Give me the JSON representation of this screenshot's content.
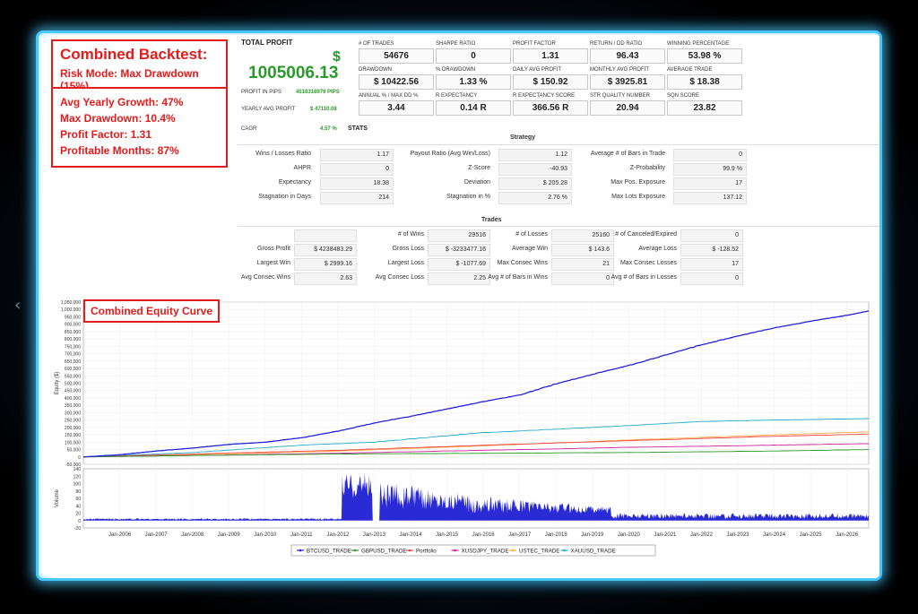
{
  "summary_box": {
    "title": "Combined Backtest:",
    "risk_mode": "Risk Mode: Max Drawdown (15%)",
    "avg_growth": "Avg Yearly Growth: 47%",
    "max_drawdown": "Max Drawdown: 10.4%",
    "profit_factor": "Profit Factor: 1.31",
    "profitable_months": "Profitable Months: 87%"
  },
  "total_profit": {
    "label": "TOTAL PROFIT",
    "currency": "$",
    "value": "1005006.13",
    "pips_label": "PROFIT IN PIPS",
    "pips_value": "4518318979 PIPS",
    "yearly_avg_label": "YEARLY AVG PROFIT",
    "yearly_avg_value": "$ 47110.08",
    "cagr_label": "CAGR",
    "cagr_value": "4.57 %",
    "stats_label": "STATS"
  },
  "stat_grid": [
    {
      "label": "# OF TRADES",
      "value": "54676"
    },
    {
      "label": "SHARPE RATIO",
      "value": "0"
    },
    {
      "label": "PROFIT FACTOR",
      "value": "1.31"
    },
    {
      "label": "RETURN / DD RATIO",
      "value": "96.43"
    },
    {
      "label": "WINNING PERCENTAGE",
      "value": "53.98 %"
    },
    {
      "label": "DRAWDOWN",
      "value": "$ 10422.56"
    },
    {
      "label": "% DRAWDOWN",
      "value": "1.33 %"
    },
    {
      "label": "DAILY AVG PROFIT",
      "value": "$ 150.92"
    },
    {
      "label": "MONTHLY AVG PROFIT",
      "value": "$ 3925.81"
    },
    {
      "label": "AVERAGE TRADE",
      "value": "$ 18.38"
    },
    {
      "label": "ANNUAL % / MAX DD %",
      "value": "3.44"
    },
    {
      "label": "R EXPECTANCY",
      "value": "0.14 R"
    },
    {
      "label": "R EXPECTANCY SCORE",
      "value": "366.56 R"
    },
    {
      "label": "STR QUALITY NUMBER",
      "value": "20.94"
    },
    {
      "label": "SQN SCORE",
      "value": "23.82"
    }
  ],
  "strategy": {
    "title": "Strategy",
    "rows": [
      [
        {
          "label": "Wins / Losses Ratio",
          "value": "1.17"
        },
        {
          "label": "Payout Ratio (Avg Win/Loss)",
          "value": "1.12"
        },
        {
          "label": "Average # of Bars in Trade",
          "value": "0"
        }
      ],
      [
        {
          "label": "AHPR",
          "value": "0"
        },
        {
          "label": "Z-Score",
          "value": "-40.93"
        },
        {
          "label": "Z-Probability",
          "value": "99.9 %"
        }
      ],
      [
        {
          "label": "Expectancy",
          "value": "18.38"
        },
        {
          "label": "Deviation",
          "value": "$ 205.28"
        },
        {
          "label": "Max Pos. Exposure",
          "value": "17"
        }
      ],
      [
        {
          "label": "Stagnation in Days",
          "value": "214"
        },
        {
          "label": "Stagnation in %",
          "value": "2.76 %"
        },
        {
          "label": "Max Lots Exposure",
          "value": "137.12"
        }
      ]
    ]
  },
  "trades": {
    "title": "Trades",
    "rows": [
      [
        {
          "label": "",
          "value": ""
        },
        {
          "label": "# of Wins",
          "value": "29516"
        },
        {
          "label": "# of Losses",
          "value": "25160"
        },
        {
          "label": "# of Canceled/Expired",
          "value": "0"
        }
      ],
      [
        {
          "label": "Gross Profit",
          "value": "$ 4238483.29"
        },
        {
          "label": "Gross Loss",
          "value": "$ -3233477.16"
        },
        {
          "label": "Average Win",
          "value": "$ 143.6"
        },
        {
          "label": "Average Loss",
          "value": "$ -128.52"
        }
      ],
      [
        {
          "label": "Largest Win",
          "value": "$ 2999.16"
        },
        {
          "label": "Largest Loss",
          "value": "$ -1077.69"
        },
        {
          "label": "Max Consec Wins",
          "value": "21"
        },
        {
          "label": "Max Consec Losses",
          "value": "17"
        }
      ],
      [
        {
          "label": "Avg Consec Wins",
          "value": "2.63"
        },
        {
          "label": "Avg Consec Loss",
          "value": "2.25"
        },
        {
          "label": "Avg # of Bars in Wins",
          "value": "0"
        },
        {
          "label": "Avg # of Bars in Losses",
          "value": "0"
        }
      ]
    ]
  },
  "equity_label": "Combined Equity Curve",
  "chart_data": {
    "type": "line",
    "ylabel": "Equity ($)",
    "ylim": [
      -50000,
      1050000
    ],
    "y_ticks": [
      "1,050,000",
      "1,000,000",
      "950,000",
      "900,000",
      "850,000",
      "800,000",
      "750,000",
      "700,000",
      "650,000",
      "600,000",
      "550,000",
      "500,000",
      "450,000",
      "400,000",
      "350,000",
      "300,000",
      "250,000",
      "200,000",
      "150,000",
      "100,000",
      "50,000",
      "0",
      "-50,000"
    ],
    "x_ticks": [
      "Jan-2006",
      "Jan-2007",
      "Jan-2008",
      "Jan-2009",
      "Jan-2010",
      "Jan-2011",
      "Jan-2012",
      "Jan-2013",
      "Jan-2014",
      "Jan-2015",
      "Jan-2016",
      "Jan-2017",
      "Jan-2018",
      "Jan-2019",
      "Jan-2020",
      "Jan-2021",
      "Jan-2022",
      "Jan-2023",
      "Jan-2024",
      "Jan-2025",
      "Jan-2026"
    ],
    "x_start": 2005.0,
    "x_end": 2026.6,
    "series": [
      {
        "name": "BTCUSD_TRADE",
        "color": "#2222dd",
        "points": [
          [
            2005.0,
            0
          ],
          [
            2006.0,
            15000
          ],
          [
            2007.0,
            40000
          ],
          [
            2008.0,
            60000
          ],
          [
            2009.0,
            85000
          ],
          [
            2010.0,
            100000
          ],
          [
            2011.0,
            130000
          ],
          [
            2012.0,
            175000
          ],
          [
            2013.0,
            230000
          ],
          [
            2014.0,
            275000
          ],
          [
            2015.0,
            325000
          ],
          [
            2016.0,
            375000
          ],
          [
            2017.0,
            420000
          ],
          [
            2018.0,
            495000
          ],
          [
            2019.0,
            560000
          ],
          [
            2020.0,
            620000
          ],
          [
            2021.0,
            690000
          ],
          [
            2022.0,
            760000
          ],
          [
            2023.0,
            820000
          ],
          [
            2024.0,
            875000
          ],
          [
            2025.0,
            920000
          ],
          [
            2026.0,
            960000
          ],
          [
            2026.6,
            990000
          ]
        ]
      },
      {
        "name": "GBPUSD_TRADE",
        "color": "#2a9a2a",
        "points": [
          [
            2005.0,
            0
          ],
          [
            2008.0,
            10000
          ],
          [
            2012.0,
            20000
          ],
          [
            2016.0,
            25000
          ],
          [
            2020.0,
            30000
          ],
          [
            2024.0,
            40000
          ],
          [
            2026.6,
            50000
          ]
        ]
      },
      {
        "name": "Portfolio",
        "color": "#ee4444",
        "points": [
          [
            2005.0,
            0
          ],
          [
            2008.0,
            20000
          ],
          [
            2012.0,
            45000
          ],
          [
            2016.0,
            80000
          ],
          [
            2020.0,
            110000
          ],
          [
            2024.0,
            140000
          ],
          [
            2026.6,
            155000
          ]
        ]
      },
      {
        "name": "XUSDJPY_TRADE",
        "color": "#cc2299",
        "points": [
          [
            2005.0,
            0
          ],
          [
            2008.0,
            10000
          ],
          [
            2012.0,
            25000
          ],
          [
            2016.0,
            45000
          ],
          [
            2020.0,
            65000
          ],
          [
            2024.0,
            80000
          ],
          [
            2026.6,
            90000
          ]
        ]
      },
      {
        "name": "USTEC_TRADE",
        "color": "#ffaa44",
        "points": [
          [
            2005.0,
            0
          ],
          [
            2008.0,
            15000
          ],
          [
            2012.0,
            40000
          ],
          [
            2016.0,
            75000
          ],
          [
            2020.0,
            115000
          ],
          [
            2024.0,
            150000
          ],
          [
            2026.6,
            170000
          ]
        ]
      },
      {
        "name": "XAUUSD_TRADE",
        "color": "#22aacc",
        "points": [
          [
            2005.0,
            0
          ],
          [
            2008.0,
            30000
          ],
          [
            2011.0,
            80000
          ],
          [
            2013.0,
            100000
          ],
          [
            2016.0,
            165000
          ],
          [
            2019.0,
            200000
          ],
          [
            2022.0,
            240000
          ],
          [
            2024.0,
            250000
          ],
          [
            2026.6,
            260000
          ]
        ]
      }
    ],
    "volume": {
      "ylabel": "Volume",
      "ylim": [
        -20,
        140
      ],
      "y_ticks": [
        "140",
        "120",
        "100",
        "80",
        "60",
        "40",
        "20",
        "0",
        "-20"
      ],
      "color": "#2b2bd6"
    }
  }
}
